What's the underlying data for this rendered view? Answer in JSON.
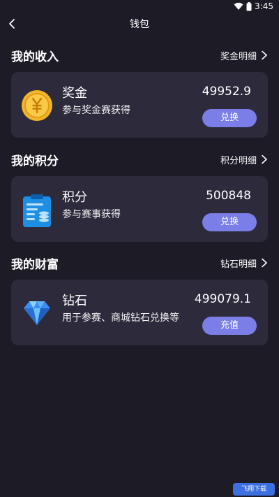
{
  "status_bar": {
    "time": "3:45"
  },
  "nav": {
    "title": "钱包"
  },
  "sections": [
    {
      "title": "我的收入",
      "link": "奖金明细",
      "card": {
        "title": "奖金",
        "desc": "参与奖金赛获得",
        "amount": "49952.9",
        "button": "兑换",
        "icon": "coin-yen-icon"
      }
    },
    {
      "title": "我的积分",
      "link": "积分明细",
      "card": {
        "title": "积分",
        "desc": "参与赛事获得",
        "amount": "500848",
        "button": "兑换",
        "icon": "clipboard-points-icon"
      }
    },
    {
      "title": "我的财富",
      "link": "钻石明细",
      "card": {
        "title": "钻石",
        "desc": "用于参赛、商城钻石兑换等",
        "amount": "499079.1",
        "button": "充值",
        "icon": "diamond-icon"
      }
    }
  ],
  "colors": {
    "background": "#1d1b26",
    "card": "#2c2a3b",
    "button": "#7b7ee6"
  },
  "watermark": "飞翔下载"
}
